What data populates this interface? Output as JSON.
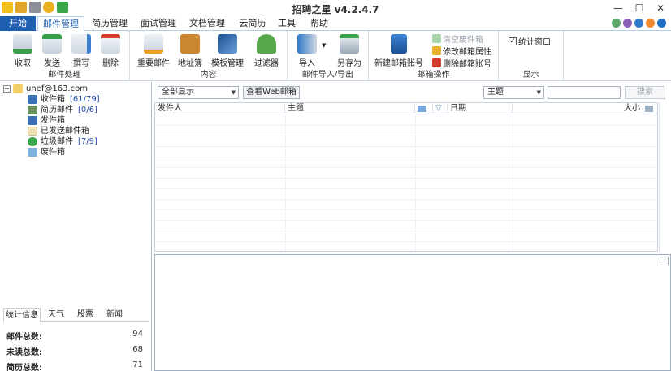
{
  "app": {
    "title": "招聘之星 v4.2.4.7"
  },
  "window": {
    "minimize": "—",
    "maximize": "☐",
    "close": "✕"
  },
  "tabs": [
    "开始",
    "邮件管理",
    "简历管理",
    "面试管理",
    "文档管理",
    "云简历",
    "工具",
    "帮助"
  ],
  "active_tab": "邮件管理",
  "ribbon": {
    "mail": {
      "label": "邮件处理",
      "receive": "收取",
      "send": "发送",
      "compose": "撰写",
      "delete": "删除"
    },
    "content": {
      "label": "内容",
      "resend": "重要邮件",
      "addressbook": "地址簿",
      "template": "模板管理",
      "filter": "过滤器"
    },
    "importexport": {
      "label": "邮件导入/导出",
      "import": "导入",
      "saveas": "另存为"
    },
    "account": {
      "label": "邮箱操作",
      "new_account": "新建邮箱账号",
      "empty_trash": "清空废件箱",
      "edit_props": "修改邮箱属性",
      "delete_account": "删除邮箱账号"
    },
    "display": {
      "label": "显示",
      "stats_window": "统计窗口"
    }
  },
  "tree": {
    "root": "unef@163.com",
    "items": [
      {
        "label": "收件箱",
        "count": "[61/79]"
      },
      {
        "label": "简历邮件",
        "count": "[0/6]"
      },
      {
        "label": "发件箱",
        "count": ""
      },
      {
        "label": "已发送邮件箱",
        "count": ""
      },
      {
        "label": "垃圾邮件",
        "count": "[7/9]"
      },
      {
        "label": "废件箱",
        "count": ""
      }
    ]
  },
  "info_tabs": [
    "统计信息",
    "天气",
    "股票",
    "新闻"
  ],
  "stats": [
    {
      "label": "邮件总数:",
      "value": "94"
    },
    {
      "label": "未读总数:",
      "value": "68"
    },
    {
      "label": "简历总数:",
      "value": "71"
    }
  ],
  "toolbar": {
    "filter_select": "全部显示",
    "web_mail_button": "查看Web邮箱",
    "search_field_select": "主题",
    "search_button": "搜索"
  },
  "grid": {
    "columns": {
      "sender": "发件人",
      "subject": "主题",
      "date": "日期",
      "size": "大小"
    }
  },
  "colors": {
    "start_tab": "#1f5fb0",
    "accent": "#1f5fb0",
    "count_blue": "#1d49b5"
  }
}
